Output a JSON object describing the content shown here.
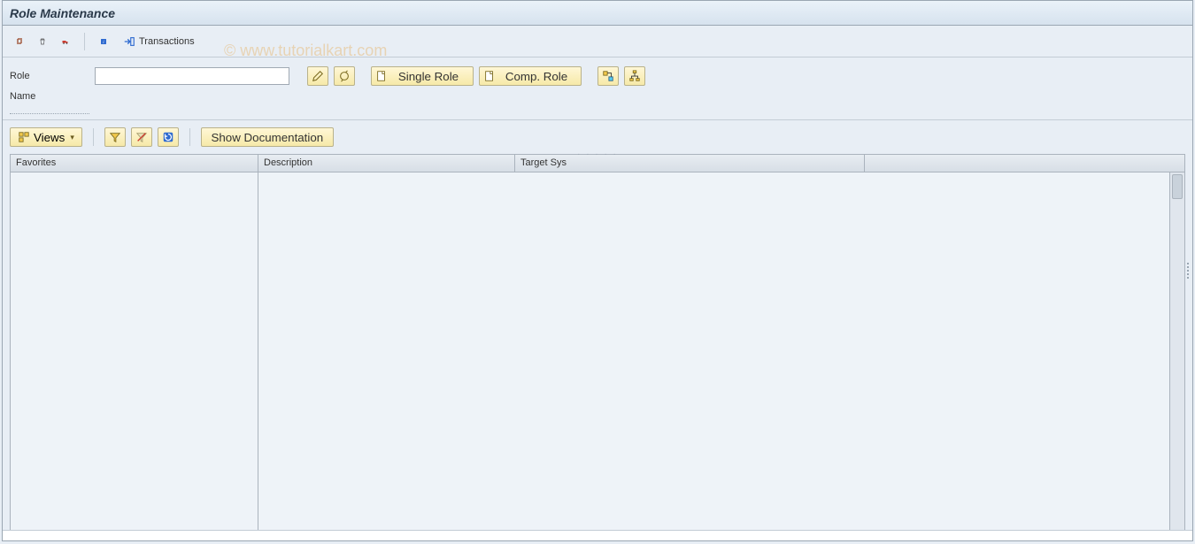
{
  "title": "Role Maintenance",
  "watermark": "© www.tutorialkart.com",
  "appbar": {
    "transactions_label": "Transactions"
  },
  "fields": {
    "role_label": "Role",
    "role_value": "",
    "name_label": "Name"
  },
  "buttons": {
    "single_role": "Single Role",
    "comp_role": "Comp. Role",
    "views": "Views",
    "show_doc": "Show Documentation"
  },
  "grid": {
    "col_favorites": "Favorites",
    "col_description": "Description",
    "col_target": "Target Sys"
  }
}
